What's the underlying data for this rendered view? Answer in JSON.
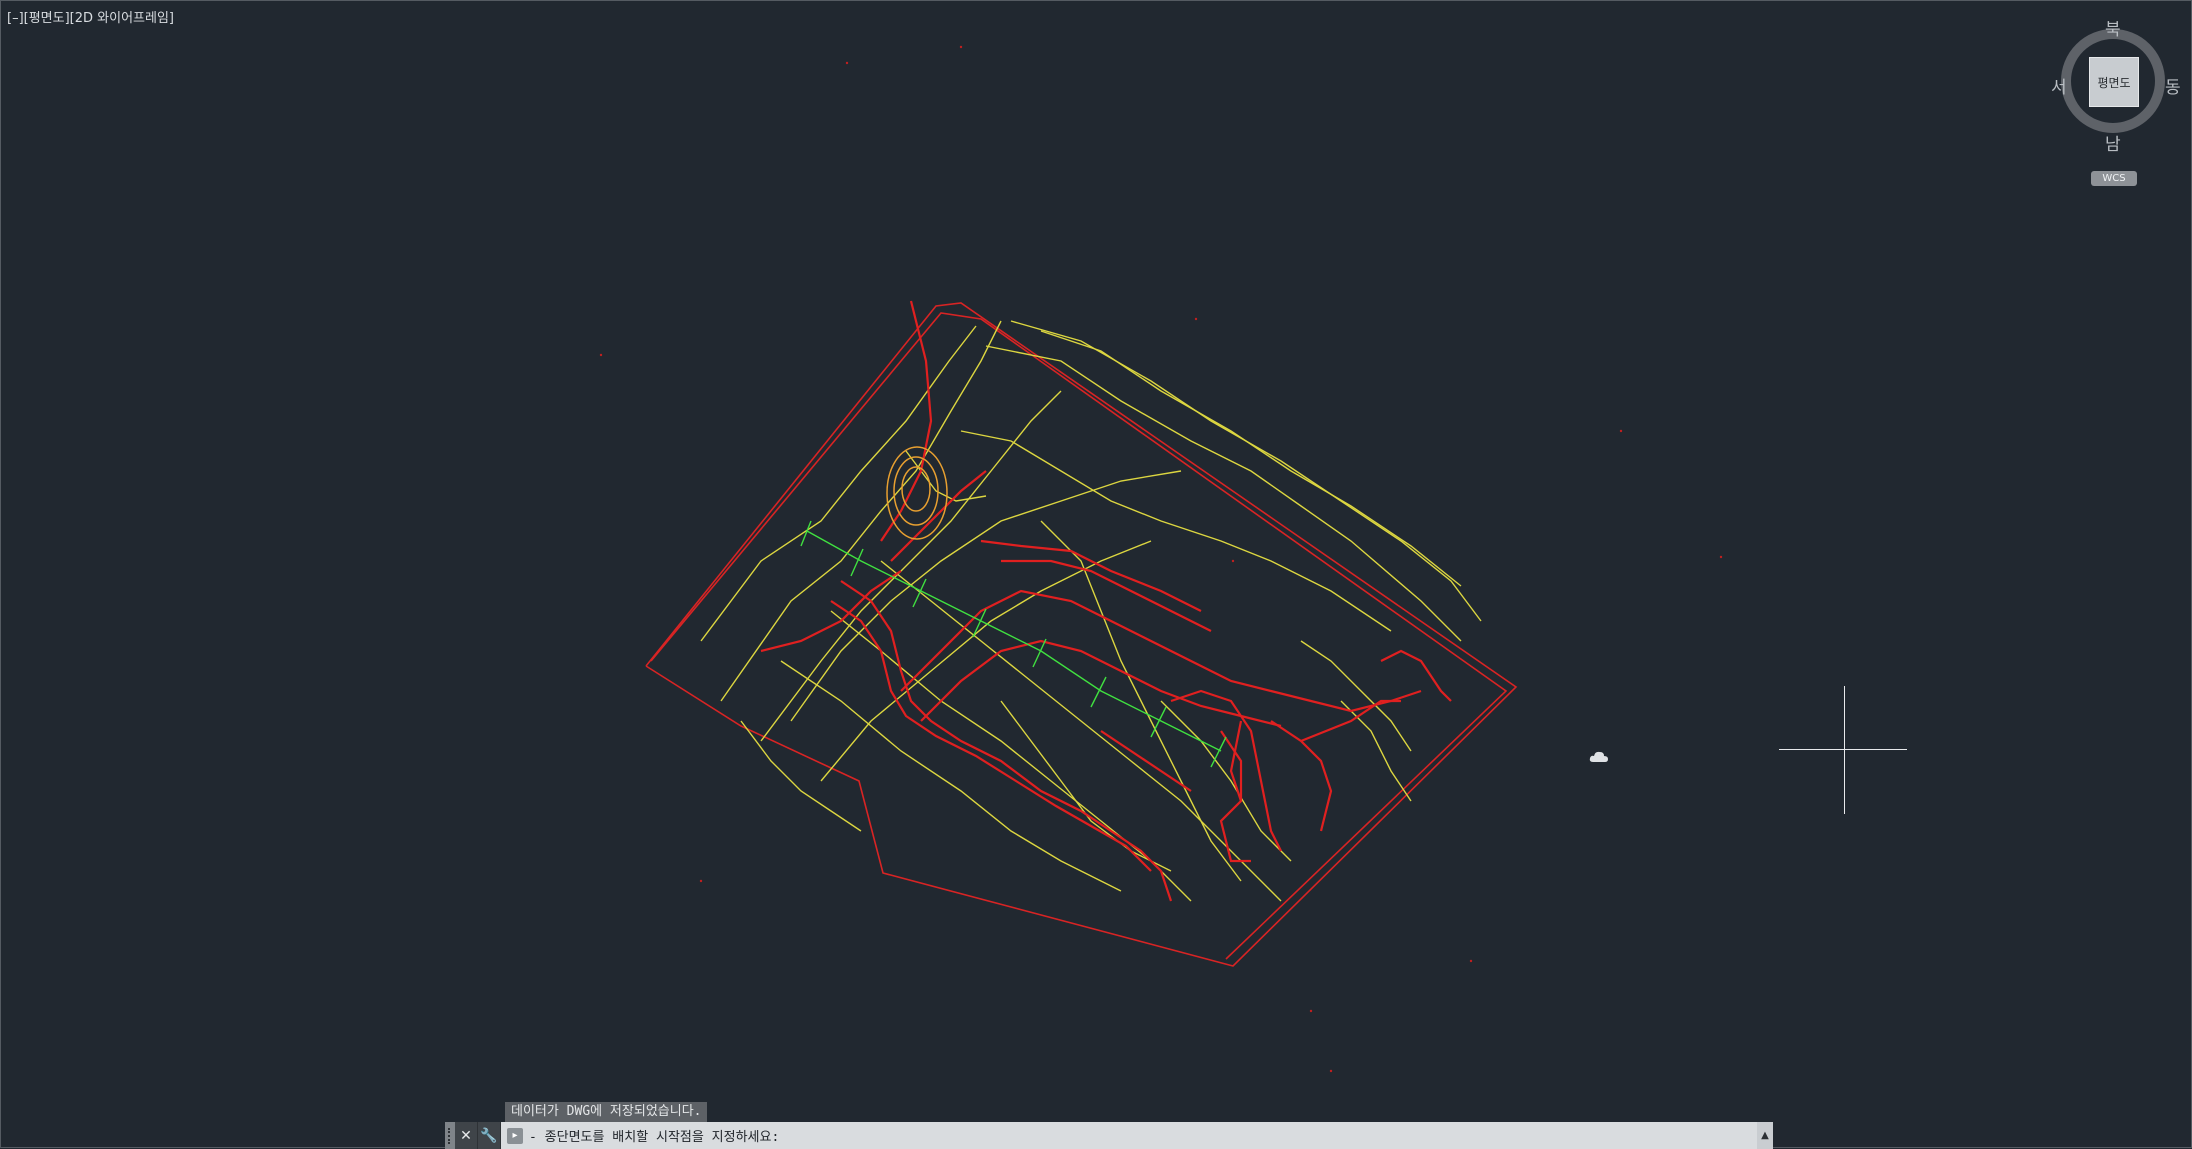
{
  "viewport": {
    "label": "[–][평면도][2D 와이어프레임]"
  },
  "viewcube": {
    "face_label": "평면도",
    "north": "북",
    "south": "남",
    "east": "동",
    "west": "서",
    "ucs_label": "WCS"
  },
  "drawing": {
    "colors": {
      "background": "#212830",
      "contour_red": "#e02020",
      "contour_yellow": "#e8e040",
      "alignment_green": "#40e040",
      "boundary": "#e02828"
    }
  },
  "command": {
    "history_line": "데이터가 DWG에 저장되었습니다.",
    "prompt": "- 종단면도를 배치할 시작점을 지정하세요:",
    "input_value": "",
    "close_icon": "close-icon",
    "customize_icon": "wrench-icon",
    "prompt_icon": "command-prompt-icon",
    "scroll_icon": "chevron-up-icon"
  }
}
